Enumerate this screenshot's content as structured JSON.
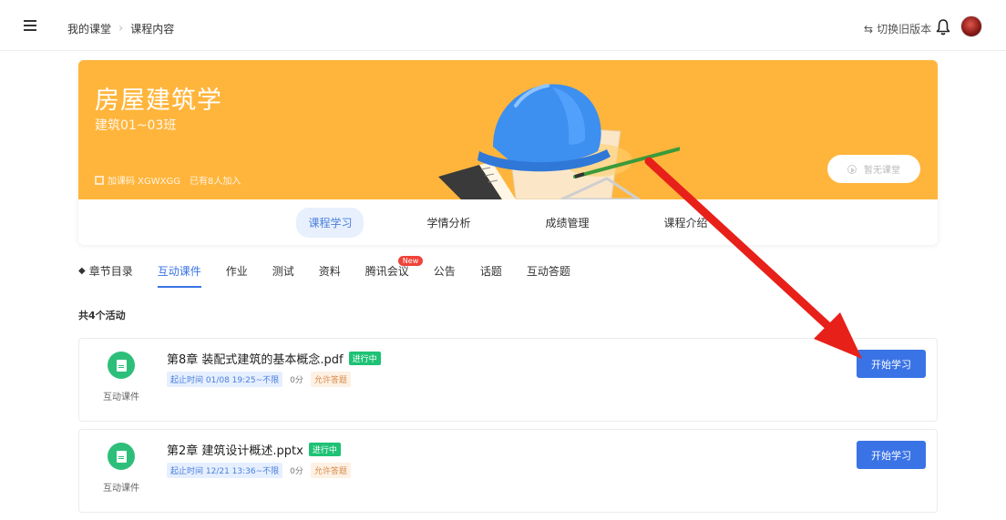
{
  "header": {
    "breadcrumb": [
      "我的课堂",
      "课程内容"
    ],
    "switch_version_label": "切换旧版本"
  },
  "course": {
    "title": "房屋建筑学",
    "class_name": "建筑01~03班",
    "join_code_label": "加课码 XGWXGG",
    "joined_label": "已有8人加入",
    "no_class_label": "暂无课堂",
    "banner_color": "#ffb53c"
  },
  "main_tabs": [
    {
      "label": "课程学习",
      "active": true
    },
    {
      "label": "学情分析",
      "active": false
    },
    {
      "label": "成绩管理",
      "active": false
    },
    {
      "label": "课程介绍",
      "active": false
    }
  ],
  "sub_tabs": {
    "chapter": "章节目录",
    "courseware": "互动课件",
    "homework": "作业",
    "test": "测试",
    "materials": "资料",
    "meeting": "腾讯会议",
    "meeting_badge": "New",
    "notice": "公告",
    "topic": "话题",
    "qa": "互动答题"
  },
  "activity_count": "共4个活动",
  "activities": [
    {
      "title": "第8章 装配式建筑的基本概念.pdf",
      "status": "进行中",
      "time": "起止时间 01/08 19:25~不限",
      "score": "0分",
      "allow": "允许答题",
      "type": "互动课件",
      "button": "开始学习"
    },
    {
      "title": "第2章 建筑设计概述.pptx",
      "status": "进行中",
      "time": "起止时间 12/21 13:36~不限",
      "score": "0分",
      "allow": "允许答题",
      "type": "互动课件",
      "button": "开始学习"
    }
  ],
  "colors": {
    "accent": "#3a73e5",
    "status_green": "#1ec275",
    "arrow_red": "#e8201a"
  }
}
